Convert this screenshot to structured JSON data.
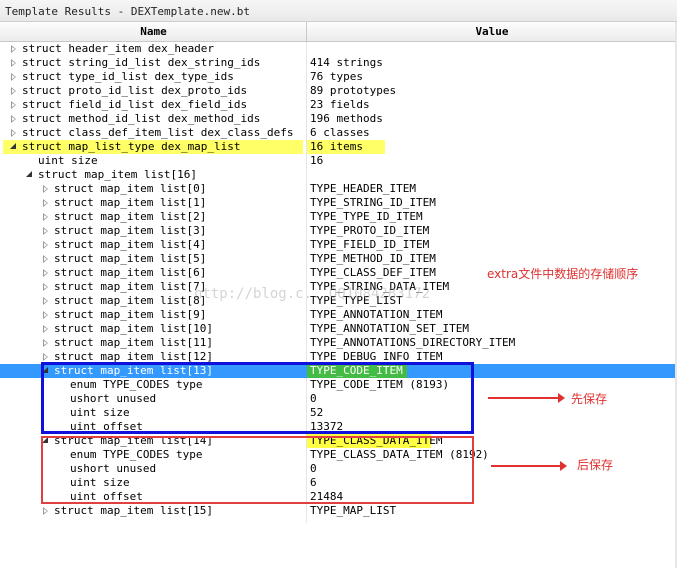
{
  "window": {
    "title": "Template Results - DEXTemplate.new.bt"
  },
  "columns": {
    "name": "Name",
    "value": "Value"
  },
  "rows": [
    {
      "indent": 0,
      "toggle": "closed",
      "name": "struct header_item dex_header",
      "value": ""
    },
    {
      "indent": 0,
      "toggle": "closed",
      "name": "struct string_id_list dex_string_ids",
      "value": "414 strings"
    },
    {
      "indent": 0,
      "toggle": "closed",
      "name": "struct type_id_list dex_type_ids",
      "value": "76 types"
    },
    {
      "indent": 0,
      "toggle": "closed",
      "name": "struct proto_id_list dex_proto_ids",
      "value": "89 prototypes"
    },
    {
      "indent": 0,
      "toggle": "closed",
      "name": "struct field_id_list dex_field_ids",
      "value": "23 fields"
    },
    {
      "indent": 0,
      "toggle": "closed",
      "name": "struct method_id_list dex_method_ids",
      "value": "196 methods"
    },
    {
      "indent": 0,
      "toggle": "closed",
      "name": "struct class_def_item_list dex_class_defs",
      "value": "6 classes"
    },
    {
      "indent": 0,
      "toggle": "open",
      "name": "struct map_list_type dex_map_list",
      "value": "16 items",
      "highlight": "yellow"
    },
    {
      "indent": 1,
      "toggle": "none",
      "name": "uint size",
      "value": "16"
    },
    {
      "indent": 1,
      "toggle": "open",
      "name": "struct map_item list[16]",
      "value": ""
    },
    {
      "indent": 2,
      "toggle": "closed",
      "name": "struct map_item list[0]",
      "value": "TYPE_HEADER_ITEM"
    },
    {
      "indent": 2,
      "toggle": "closed",
      "name": "struct map_item list[1]",
      "value": "TYPE_STRING_ID_ITEM"
    },
    {
      "indent": 2,
      "toggle": "closed",
      "name": "struct map_item list[2]",
      "value": "TYPE_TYPE_ID_ITEM"
    },
    {
      "indent": 2,
      "toggle": "closed",
      "name": "struct map_item list[3]",
      "value": "TYPE_PROTO_ID_ITEM"
    },
    {
      "indent": 2,
      "toggle": "closed",
      "name": "struct map_item list[4]",
      "value": "TYPE_FIELD_ID_ITEM"
    },
    {
      "indent": 2,
      "toggle": "closed",
      "name": "struct map_item list[5]",
      "value": "TYPE_METHOD_ID_ITEM"
    },
    {
      "indent": 2,
      "toggle": "closed",
      "name": "struct map_item list[6]",
      "value": "TYPE_CLASS_DEF_ITEM"
    },
    {
      "indent": 2,
      "toggle": "closed",
      "name": "struct map_item list[7]",
      "value": "TYPE_STRING_DATA_ITEM"
    },
    {
      "indent": 2,
      "toggle": "closed",
      "name": "struct map_item list[8]",
      "value": "TYPE_TYPE_LIST"
    },
    {
      "indent": 2,
      "toggle": "closed",
      "name": "struct map_item list[9]",
      "value": "TYPE_ANNOTATION_ITEM"
    },
    {
      "indent": 2,
      "toggle": "closed",
      "name": "struct map_item list[10]",
      "value": "TYPE_ANNOTATION_SET_ITEM"
    },
    {
      "indent": 2,
      "toggle": "closed",
      "name": "struct map_item list[11]",
      "value": "TYPE_ANNOTATIONS_DIRECTORY_ITEM"
    },
    {
      "indent": 2,
      "toggle": "closed",
      "name": "struct map_item list[12]",
      "value": "TYPE_DEBUG_INFO_ITEM"
    },
    {
      "indent": 2,
      "toggle": "open",
      "name": "struct map_item list[13]",
      "value": "TYPE_CODE_ITEM",
      "selected": true,
      "valuebg": "green"
    },
    {
      "indent": 3,
      "toggle": "none",
      "name": "enum TYPE_CODES type",
      "value": "TYPE_CODE_ITEM (8193)"
    },
    {
      "indent": 3,
      "toggle": "none",
      "name": "ushort unused",
      "value": "0"
    },
    {
      "indent": 3,
      "toggle": "none",
      "name": "uint size",
      "value": "52"
    },
    {
      "indent": 3,
      "toggle": "none",
      "name": "uint offset",
      "value": "13372"
    },
    {
      "indent": 2,
      "toggle": "open",
      "name": "struct map_item list[14]",
      "value": "TYPE_CLASS_DATA_ITEM",
      "valuebg": "yellow"
    },
    {
      "indent": 3,
      "toggle": "none",
      "name": "enum TYPE_CODES type",
      "value": "TYPE_CLASS_DATA_ITEM (8192)"
    },
    {
      "indent": 3,
      "toggle": "none",
      "name": "ushort unused",
      "value": "0"
    },
    {
      "indent": 3,
      "toggle": "none",
      "name": "uint size",
      "value": "6"
    },
    {
      "indent": 3,
      "toggle": "none",
      "name": "uint offset",
      "value": "21484"
    },
    {
      "indent": 2,
      "toggle": "closed",
      "name": "struct map_item list[15]",
      "value": "TYPE_MAP_LIST"
    }
  ],
  "annotations": {
    "top_note": "extra文件中数据的存储顺序",
    "first_saved": "先保存",
    "later_saved": "后保存"
  },
  "watermark": "http://blog.c...QQ1084283172",
  "colors": {
    "selection": "#3399ff",
    "highlight_yellow": "#ffff66",
    "highlight_green": "#44bb44",
    "box_blue": "#1010dd",
    "box_red": "#e04040",
    "annotation_red": "#e03030"
  }
}
